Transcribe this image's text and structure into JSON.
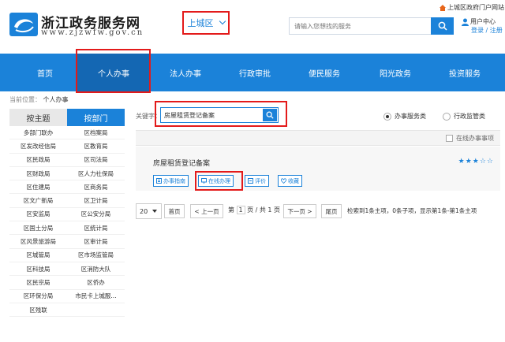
{
  "header": {
    "site_title": "浙江政务服务网",
    "site_url": "www.zjzwfw.gov.cn",
    "region": "上城区",
    "portal_link": "上城区政府门户网站",
    "search_placeholder": "请输入您想找的服务",
    "user_center": "用户中心",
    "login": "登录",
    "separator": "/",
    "register": "注册"
  },
  "nav": {
    "items": [
      "首页",
      "个人办事",
      "法人办事",
      "行政审批",
      "便民服务",
      "阳光政务",
      "投资服务"
    ],
    "active_index": 1
  },
  "breadcrumb": {
    "label": "当前位置：",
    "current": "个人办事"
  },
  "sidebar": {
    "tab_topic": "按主题",
    "tab_department": "按部门",
    "active_tab": "按部门",
    "departments": [
      [
        "多部门联办",
        "区档案局"
      ],
      [
        "区发改经信局",
        "区教育局"
      ],
      [
        "区民政局",
        "区司法局"
      ],
      [
        "区财政局",
        "区人力社保局"
      ],
      [
        "区住建局",
        "区商务局"
      ],
      [
        "区文广新局",
        "区卫计局"
      ],
      [
        "区安监局",
        "区公安分局"
      ],
      [
        "区国土分局",
        "区统计局"
      ],
      [
        "区风景旅游局",
        "区审计局"
      ],
      [
        "区城管局",
        "区市场监管局"
      ],
      [
        "区科技局",
        "区消防大队"
      ],
      [
        "区民宗局",
        "区侨办"
      ],
      [
        "区环保分局",
        "市民卡上城服..."
      ],
      [
        "区残联",
        ""
      ]
    ]
  },
  "filter": {
    "keyword_label": "关键字：",
    "keyword_value": "房屋租赁登记备案",
    "radio_service": "办事服务类",
    "radio_supervision": "行政监管类",
    "selected": "办事服务类",
    "online_only_label": "在线办事事项"
  },
  "result": {
    "title": "房屋租赁登记备案",
    "rating": 3,
    "rating_max": 5,
    "actions": [
      "办事指南",
      "在线办理",
      "评价",
      "收藏"
    ]
  },
  "pager": {
    "page_size": "20",
    "first": "首页",
    "prev": "< 上一页",
    "page_prefix": "第",
    "current_page": "1",
    "page_suffix": "页 / 共 1 页",
    "next": "下一页 >",
    "last": "尾页",
    "summary": "检索到1条主项，0条子项，显示第1条-第1条主项"
  },
  "colors": {
    "accent": "#1b82d9",
    "nav_active": "#1467b3",
    "highlight": "#e31a1a"
  }
}
